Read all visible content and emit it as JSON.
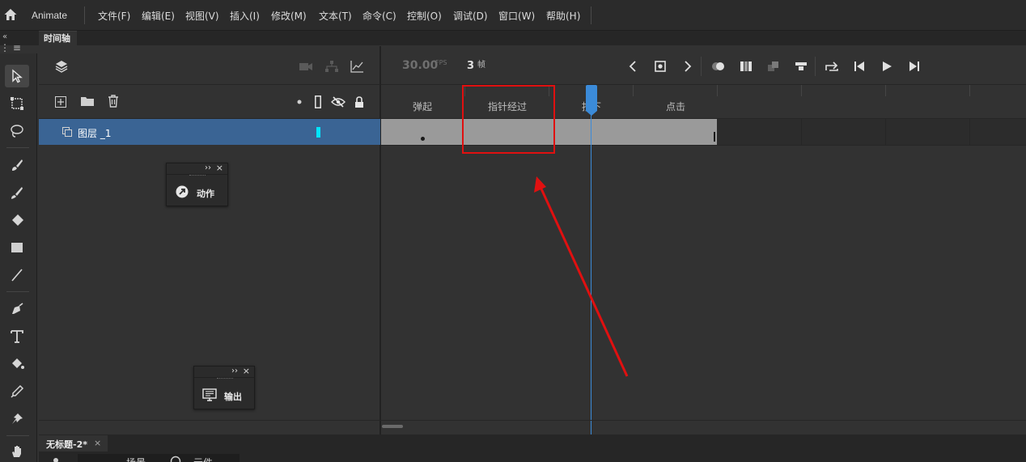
{
  "app": {
    "name": "Animate"
  },
  "menu": [
    "文件(F)",
    "编辑(E)",
    "视图(V)",
    "插入(I)",
    "修改(M)",
    "文本(T)",
    "命令(C)",
    "控制(O)",
    "调试(D)",
    "窗口(W)",
    "帮助(H)"
  ],
  "panel_tab": {
    "label": "时间轴"
  },
  "layers": [
    {
      "name": "图层 _1",
      "color": "#00e5ff"
    }
  ],
  "floating_panels": {
    "actions": "动作",
    "output": "输出"
  },
  "timeline": {
    "fps": "30.00",
    "fps_unit": "FPS",
    "current_frame": "3",
    "frame_unit": "帧",
    "labels": [
      "弹起",
      "指针经过",
      "按下",
      "点击"
    ]
  },
  "document": {
    "tab_title": "无标题-2*",
    "close_glyph": "×",
    "sub_items": [
      "场景",
      "元件"
    ]
  },
  "colors": {
    "selection": "#3a6494",
    "playhead": "#3b8bd9",
    "annotation": "#e01010",
    "frames_fill": "#9a9a9a"
  }
}
